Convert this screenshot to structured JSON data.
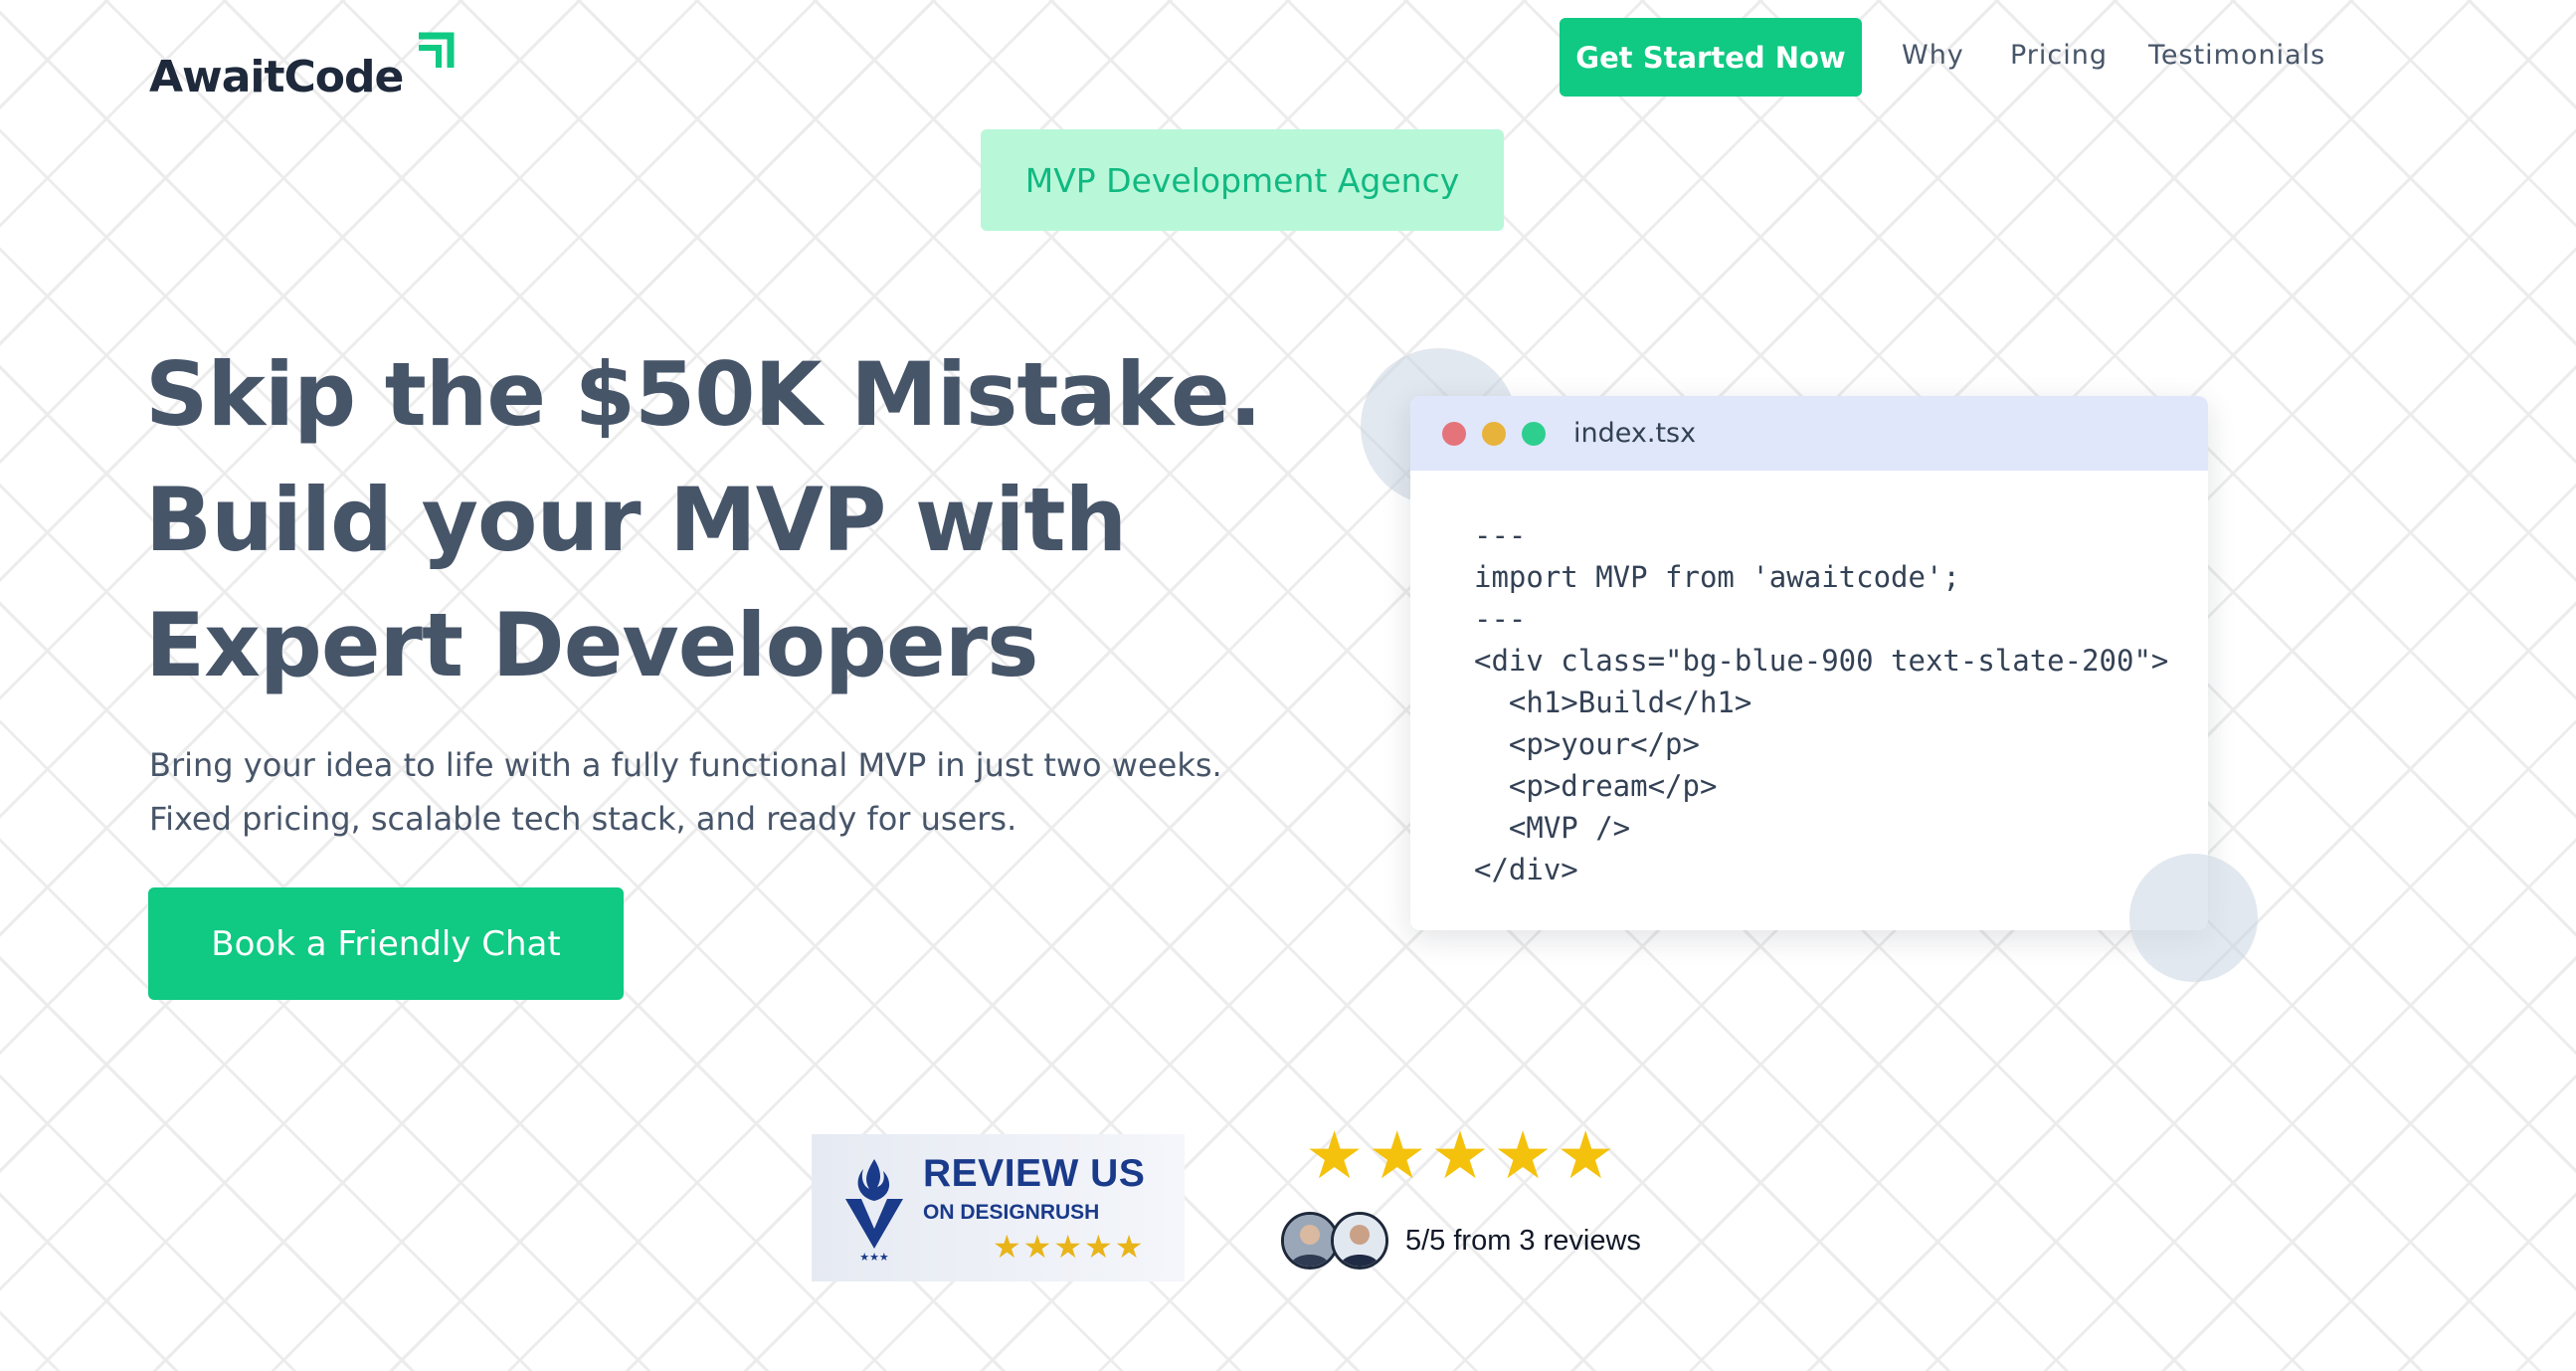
{
  "header": {
    "logo_text": "AwaitCode",
    "cta_label": "Get Started Now",
    "nav": [
      "Why",
      "Pricing",
      "Testimonials"
    ]
  },
  "badge_label": "MVP Development Agency",
  "hero": {
    "headline": [
      "Skip the $50K Mistake.",
      "Build your MVP with",
      "Expert Developers"
    ],
    "subtext": "Bring your idea to life with a fully functional MVP in just two weeks. Fixed pricing, scalable tech stack, and ready for users.",
    "cta_label": "Book a Friendly Chat"
  },
  "code_window": {
    "filename": "index.tsx",
    "lines": [
      "---",
      "import MVP from 'awaitcode';",
      "---",
      "<div class=\"bg-blue-900 text-slate-200\">",
      "  <h1>Build</h1>",
      "  <p>your</p>",
      "  <p>dream</p>",
      "  <MVP />",
      "</div>"
    ]
  },
  "reviews": {
    "designrush_title": "REVIEW US",
    "designrush_subtitle": "ON DESIGNRUSH",
    "designrush_stars": "★★★★★",
    "rating_stars": "★★★★★",
    "rating_value": 5,
    "rating_text": "5/5 from 3 reviews"
  },
  "colors": {
    "accent": "#10c983",
    "badge_bg": "#b9f7d9",
    "text": "#475569",
    "code_titlebar": "#e0e7fb",
    "dot_red": "#e5737a",
    "dot_yellow": "#e8b33a",
    "dot_green": "#2ecf8e",
    "star": "#f4c20d"
  },
  "icons": {
    "logo_mark": "arrow-up-right-icon",
    "designrush_logo": "designrush-flame-v-icon"
  }
}
